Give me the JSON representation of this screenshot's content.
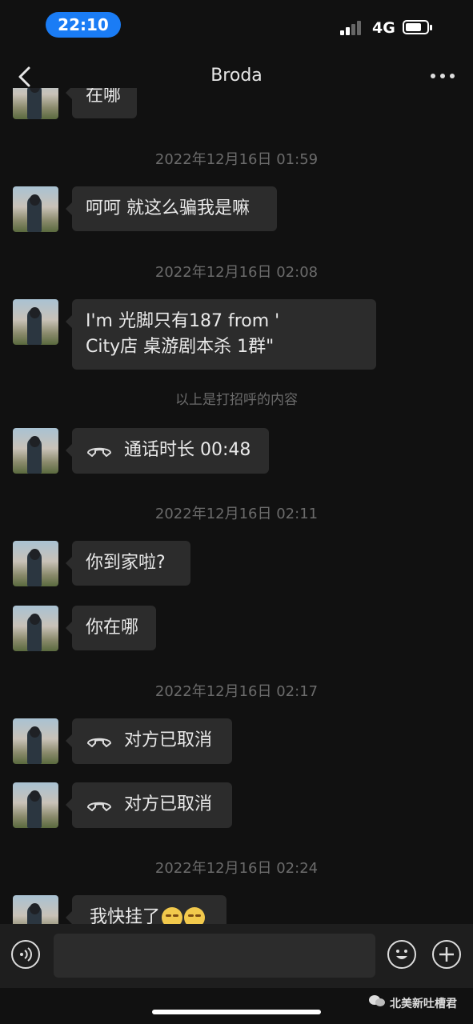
{
  "status": {
    "time": "22:10",
    "network": "4G"
  },
  "nav": {
    "title": "Broda"
  },
  "messages": {
    "m0": "在哪",
    "ts1": "2022年12月16日 01:59",
    "m1": "呵呵 就这么骗我是嘛",
    "ts2": "2022年12月16日 02:08",
    "m2_line1": "I'm 光脚只有187 from '",
    "m2_line2": "City店 桌游剧本杀 1群\"",
    "sys1": "以上是打招呼的内容",
    "m3": "通话时长 00:48",
    "ts3": "2022年12月16日 02:11",
    "m4": "你到家啦?",
    "m5": "你在哪",
    "ts4": "2022年12月16日 02:17",
    "m6": "对方已取消",
    "m7": "对方已取消",
    "ts5": "2022年12月16日 02:24",
    "m8": "我快挂了"
  },
  "input": {
    "placeholder": ""
  },
  "watermark": {
    "text": "北美新吐槽君"
  },
  "colors": {
    "background": "#111111",
    "bubble": "#2c2c2c",
    "time_pill": "#1a7cf5"
  }
}
